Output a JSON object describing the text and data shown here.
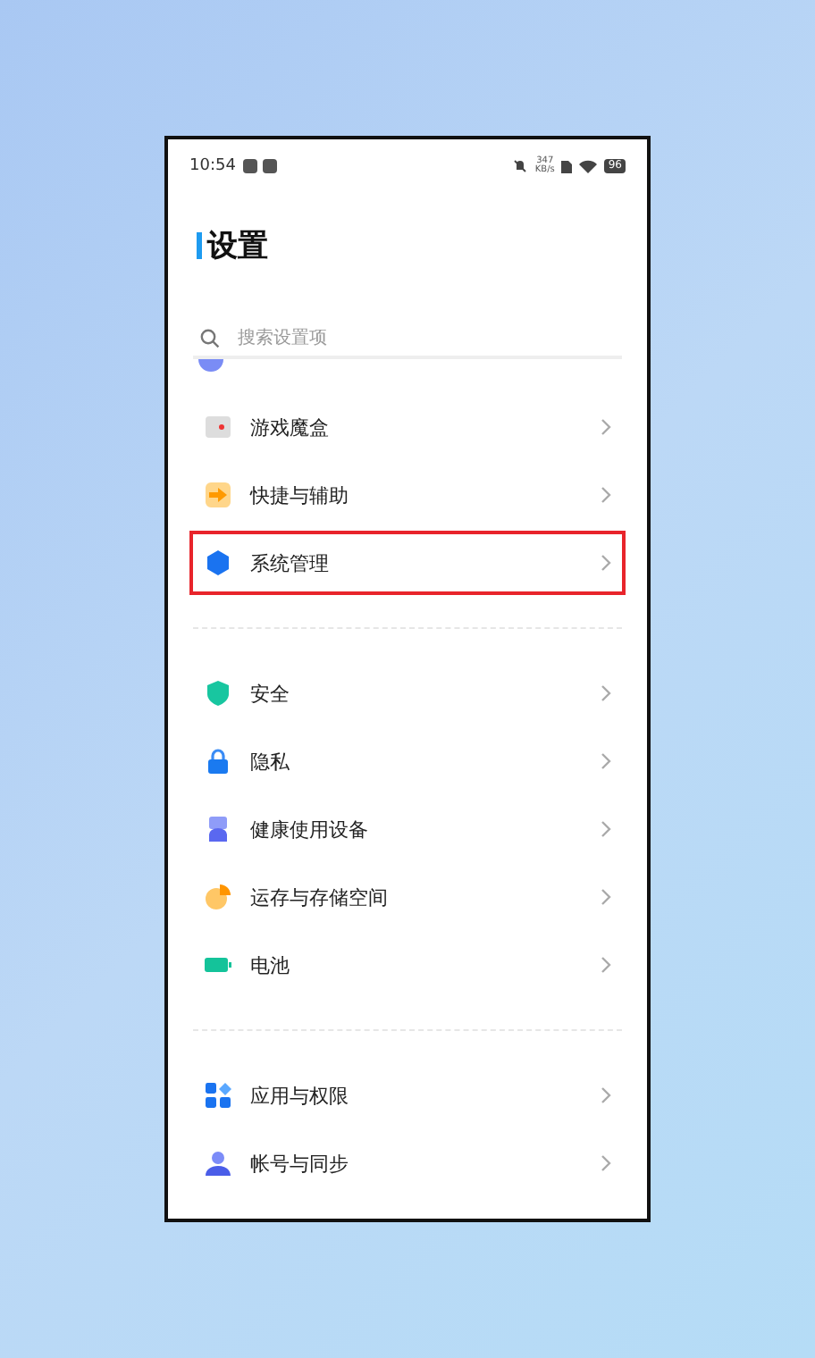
{
  "status_bar": {
    "time": "10:54",
    "net_speed": [
      "347",
      "KB/s"
    ],
    "battery": "96"
  },
  "title": "设置",
  "search": {
    "placeholder": "搜索设置项"
  },
  "sections": [
    [
      {
        "label": "游戏魔盒",
        "highlighted": false
      },
      {
        "label": "快捷与辅助",
        "highlighted": false
      },
      {
        "label": "系统管理",
        "highlighted": true
      }
    ],
    [
      {
        "label": "安全",
        "highlighted": false
      },
      {
        "label": "隐私",
        "highlighted": false
      },
      {
        "label": "健康使用设备",
        "highlighted": false
      },
      {
        "label": "运存与存储空间",
        "highlighted": false
      },
      {
        "label": "电池",
        "highlighted": false
      }
    ],
    [
      {
        "label": "应用与权限",
        "highlighted": false
      },
      {
        "label": "帐号与同步",
        "highlighted": false
      }
    ]
  ]
}
